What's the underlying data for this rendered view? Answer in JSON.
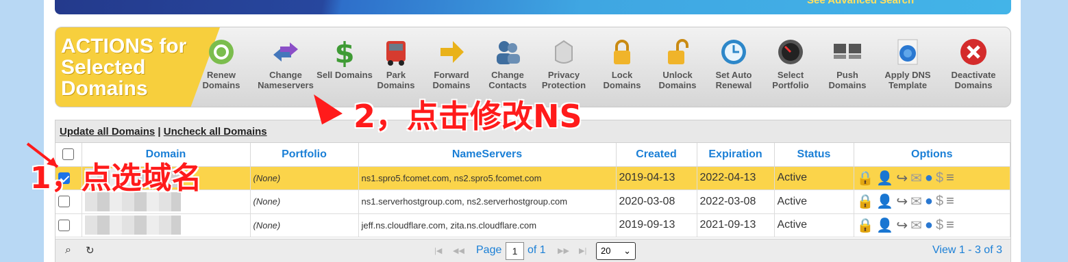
{
  "banner": {
    "text": "See Advanced Search"
  },
  "actions": {
    "title": "ACTIONS for Selected Domains",
    "items": [
      {
        "label": "Renew Domains",
        "icon": "renew-icon",
        "color": "#5aa33a"
      },
      {
        "label": "Change Nameservers",
        "icon": "swap-arrows-icon",
        "color": "#4477bb"
      },
      {
        "label": "Sell Domains",
        "icon": "dollar-icon",
        "color": "#3f9b35"
      },
      {
        "label": "Park Domains",
        "icon": "truck-icon",
        "color": "#d63b2f"
      },
      {
        "label": "Forward Domains",
        "icon": "arrow-right-icon",
        "color": "#e9b21a"
      },
      {
        "label": "Change Contacts",
        "icon": "contacts-icon",
        "color": "#3f6e9f"
      },
      {
        "label": "Privacy Protection",
        "icon": "privacy-icon",
        "color": "#aaaaaa"
      },
      {
        "label": "Lock Domains",
        "icon": "lock-icon",
        "color": "#e8a316"
      },
      {
        "label": "Unlock Domains",
        "icon": "unlock-icon",
        "color": "#e8a316"
      },
      {
        "label": "Set Auto Renewal",
        "icon": "clock-icon",
        "color": "#2d87c9"
      },
      {
        "label": "Select Portfolio",
        "icon": "gauge-icon",
        "color": "#444444"
      },
      {
        "label": "Push Domains",
        "icon": "servers-icon",
        "color": "#555555"
      },
      {
        "label": "Apply DNS Template",
        "icon": "globe-doc-icon",
        "color": "#2a78d1"
      },
      {
        "label": "Deactivate Domains",
        "icon": "deactivate-icon",
        "color": "#d42b2b"
      }
    ]
  },
  "annotations": {
    "step1": "1，点选域名",
    "step2": "2，点击修改NS"
  },
  "table": {
    "update_all": "Update all Domains",
    "separator": "|",
    "uncheck_all": "Uncheck all Domains",
    "headers": [
      "Domain",
      "Portfolio",
      "NameServers",
      "Created",
      "Expiration",
      "Status",
      "Options"
    ],
    "rows": [
      {
        "checked": true,
        "portfolio": "(None)",
        "nameservers": "ns1.spro5.fcomet.com, ns2.spro5.fcomet.com",
        "created": "2019-04-13",
        "expiration": "2022-04-13",
        "status": "Active"
      },
      {
        "checked": false,
        "portfolio": "(None)",
        "nameservers": "ns1.serverhostgroup.com, ns2.serverhostgroup.com",
        "created": "2020-03-08",
        "expiration": "2022-03-08",
        "status": "Active"
      },
      {
        "checked": false,
        "portfolio": "(None)",
        "nameservers": "jeff.ns.cloudflare.com, zita.ns.cloudflare.com",
        "created": "2019-09-13",
        "expiration": "2021-09-13",
        "status": "Active"
      }
    ],
    "selected_row_color": "#fbd44a"
  },
  "pager": {
    "page_label": "Page",
    "page_value": "1",
    "of_label": "of 1",
    "page_size": "20",
    "summary": "View 1 - 3 of 3"
  }
}
